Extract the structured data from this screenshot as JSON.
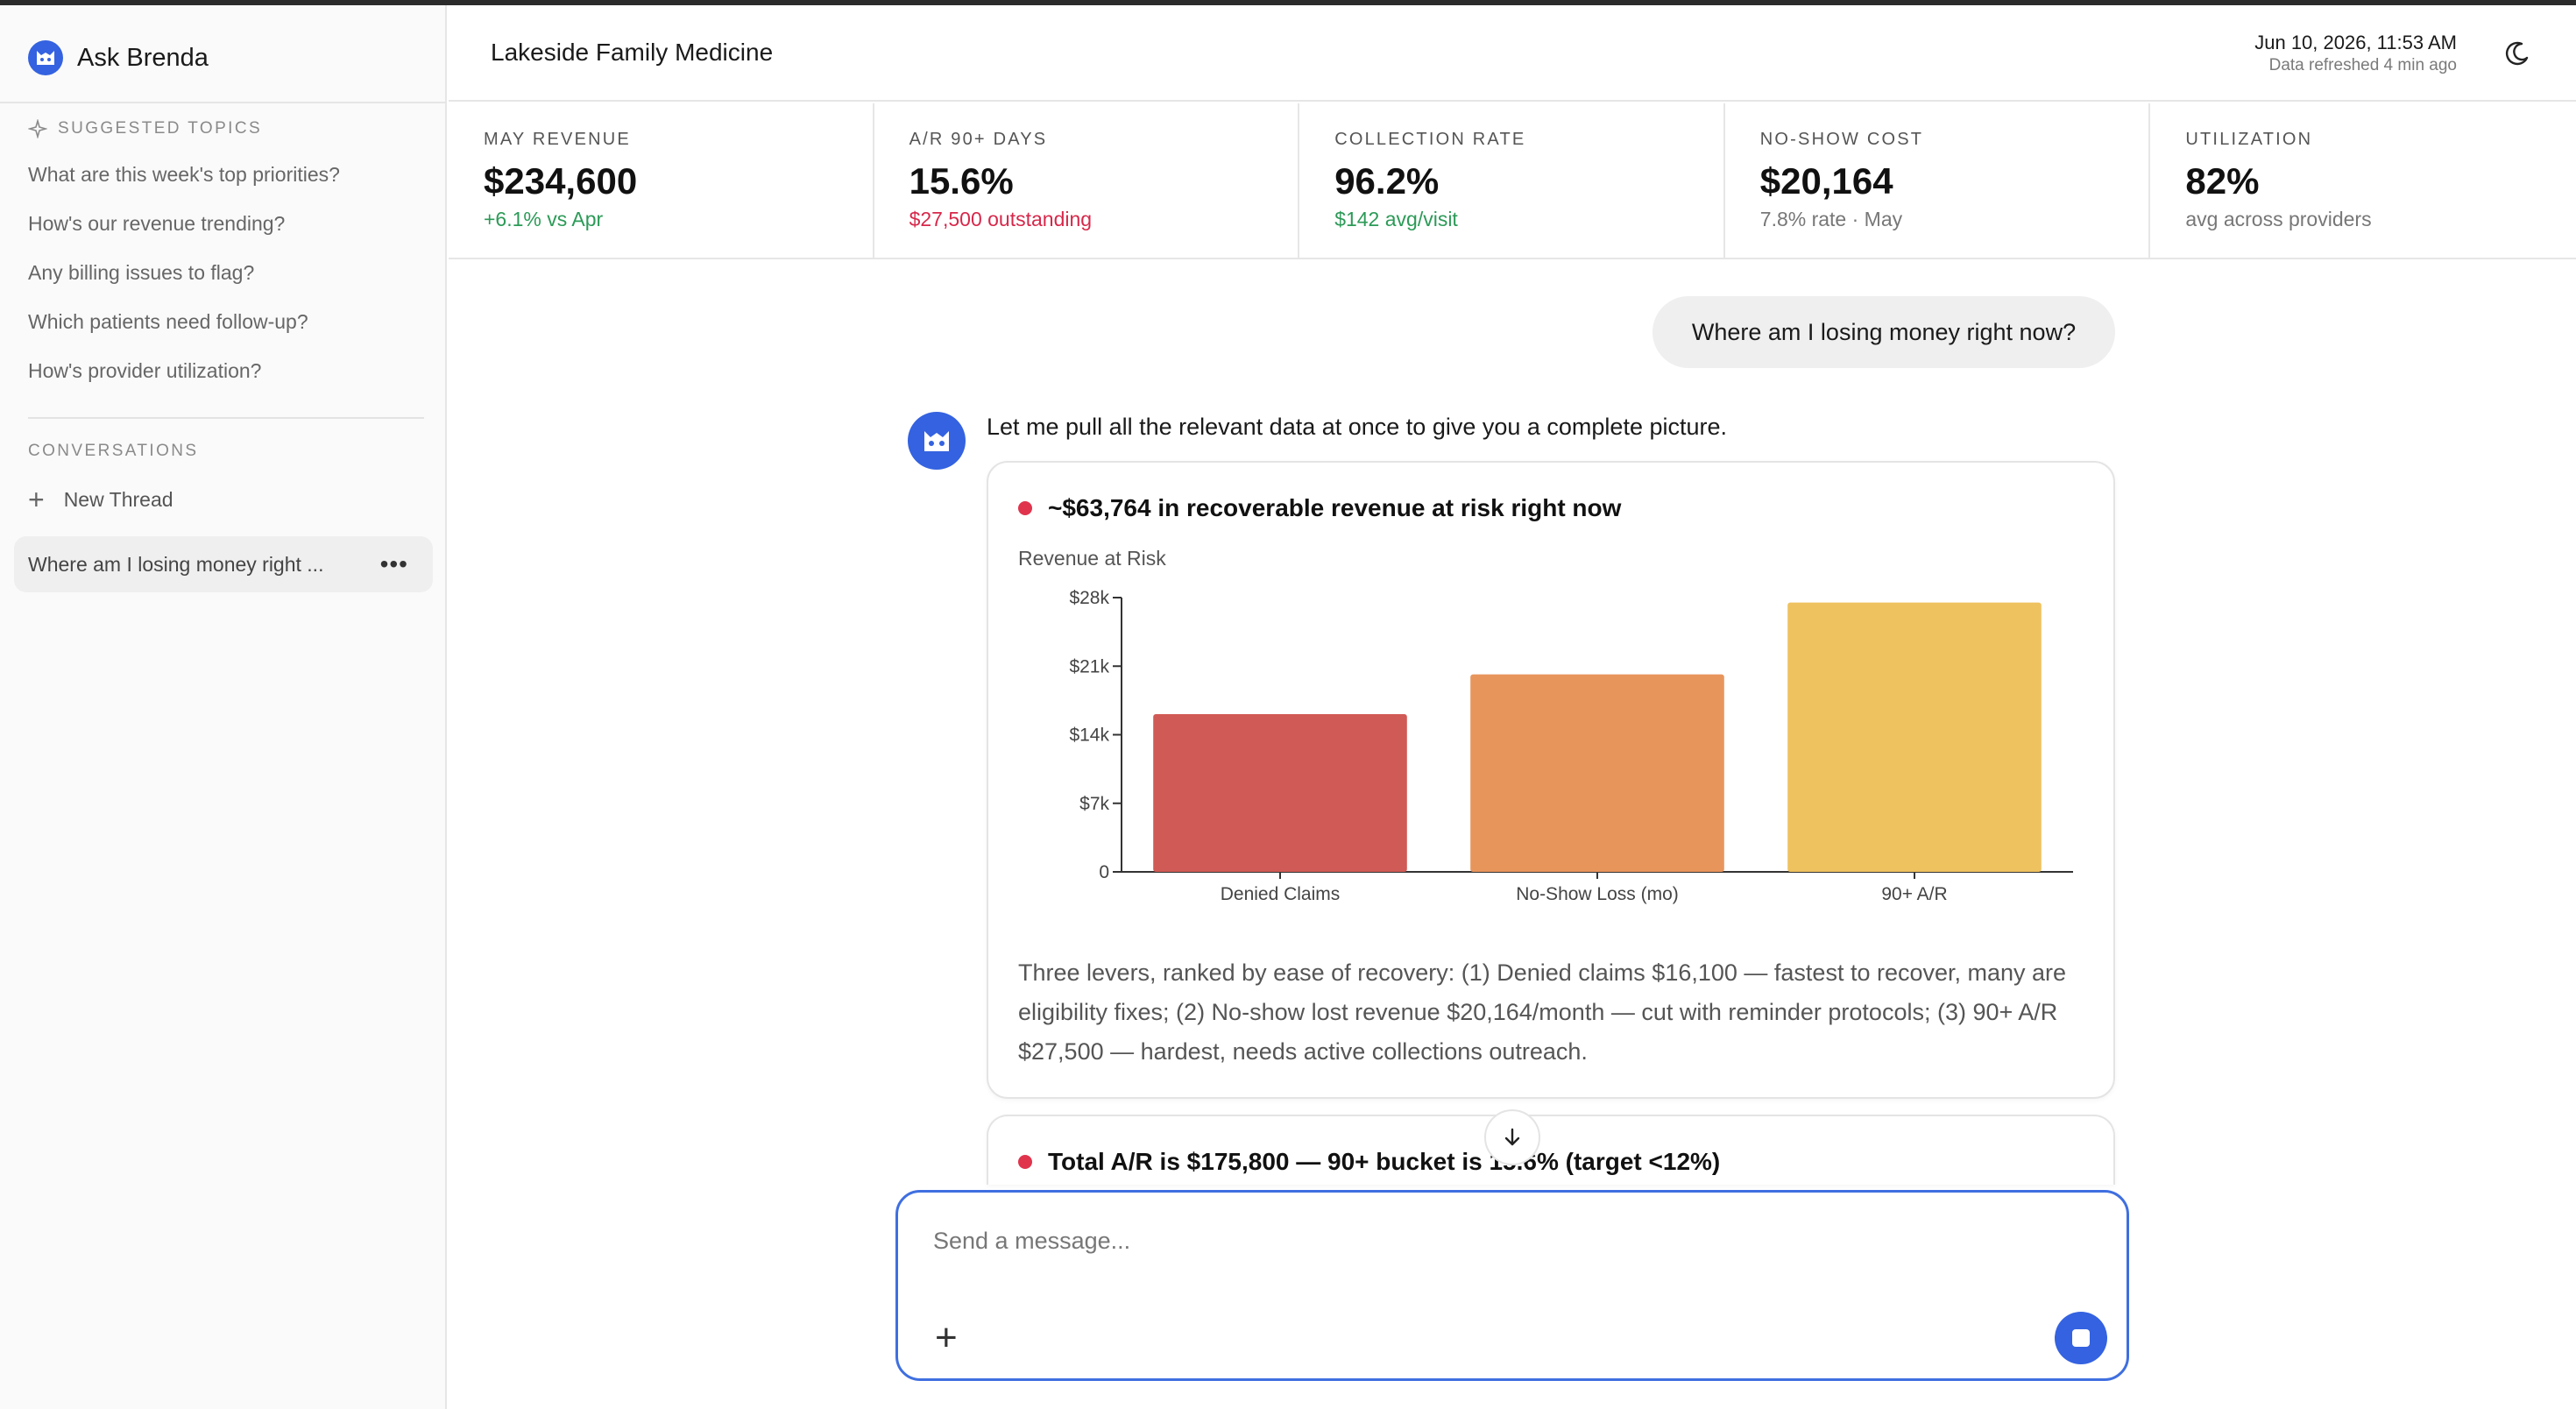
{
  "app": {
    "name": "Ask Brenda"
  },
  "sidebar": {
    "suggested_label": "SUGGESTED TOPICS",
    "topics": [
      "What are this week's top priorities?",
      "How's our revenue trending?",
      "Any billing issues to flag?",
      "Which patients need follow-up?",
      "How's provider utilization?"
    ],
    "conversations_label": "CONVERSATIONS",
    "new_thread_label": "New Thread",
    "threads": [
      {
        "title": "Where am I losing money right ..."
      }
    ]
  },
  "header": {
    "practice_name": "Lakeside Family Medicine",
    "date": "Jun 10, 2026, 11:53 AM",
    "refreshed": "Data refreshed 4 min ago"
  },
  "kpis": [
    {
      "label": "MAY REVENUE",
      "value": "$234,600",
      "sub": "+6.1% vs Apr",
      "tone": "green"
    },
    {
      "label": "A/R 90+ DAYS",
      "value": "15.6%",
      "sub": "$27,500 outstanding",
      "tone": "red"
    },
    {
      "label": "COLLECTION RATE",
      "value": "96.2%",
      "sub": "$142 avg/visit",
      "tone": "green"
    },
    {
      "label": "NO-SHOW COST",
      "value": "$20,164",
      "sub": "7.8% rate · May",
      "tone": "gray"
    },
    {
      "label": "UTILIZATION",
      "value": "82%",
      "sub": "avg across providers",
      "tone": "gray"
    }
  ],
  "chat": {
    "user_message": "Where am I losing money right now?",
    "assistant_intro": "Let me pull all the relevant data at once to give you a complete picture.",
    "card1": {
      "title": "~$63,764 in recoverable revenue at risk right now",
      "body": "Three levers, ranked by ease of recovery: (1) Denied claims $16,100 — fastest to recover, many are eligibility fixes; (2) No-show lost revenue $20,164/month — cut with reminder protocols; (3) 90+ A/R $27,500 — hardest, needs active collections outreach."
    },
    "card2": {
      "title": "Total A/R is $175,800 — 90+ bucket is 15.6% (target <12%)"
    }
  },
  "composer": {
    "placeholder": "Send a message..."
  },
  "colors": {
    "accent": "#3462e0",
    "alert_dot": "#e0344d",
    "positive": "#2c9a57",
    "negative": "#d6284a"
  },
  "chart_data": {
    "type": "bar",
    "title": "Revenue at Risk",
    "categories": [
      "Denied Claims",
      "No-Show Loss (mo)",
      "90+ A/R"
    ],
    "values": [
      16100,
      20164,
      27500
    ],
    "colors": [
      "#d05a55",
      "#e8955c",
      "#efc260"
    ],
    "yticks": [
      {
        "value": 0,
        "label": "0"
      },
      {
        "value": 7000,
        "label": "$7k"
      },
      {
        "value": 14000,
        "label": "$14k"
      },
      {
        "value": 21000,
        "label": "$21k"
      },
      {
        "value": 28000,
        "label": "$28k"
      }
    ],
    "ylim": [
      0,
      28000
    ],
    "xlabel": "",
    "ylabel": "",
    "grid": false
  }
}
